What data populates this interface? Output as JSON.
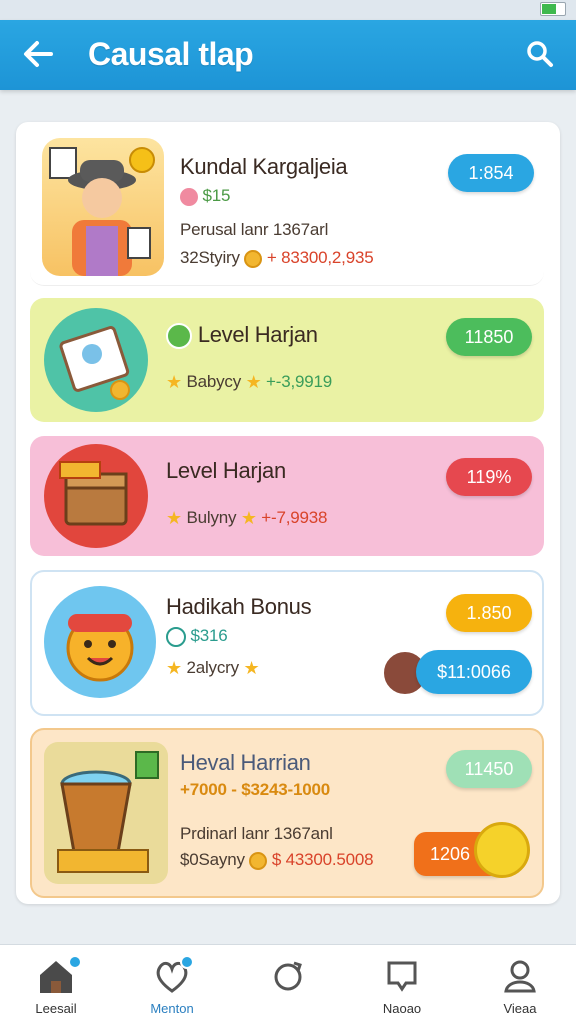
{
  "app": {
    "title": "Causal tlap"
  },
  "cards": [
    {
      "title": "Kundal Kargaljeia",
      "line1": "$15",
      "line2": "Perusal lanr 1367arl",
      "line3a": "32Styiry",
      "line3b": "+ 83300,2,935",
      "pill": "1:854"
    },
    {
      "title": "Level Harjan",
      "line1a": "Babycy",
      "line1b": "+-3,9919",
      "pill": "11850"
    },
    {
      "title": "Level Harjan",
      "line1a": "Bulyny",
      "line1b": "+-7,9938",
      "pill": "119%"
    },
    {
      "title": "Hadikah Bonus",
      "line1": "$316",
      "line2": "2alycry",
      "pill1": "1.850",
      "pill2": "$11:0066"
    },
    {
      "title": "Heval Harrian",
      "line1": "+7000 - $3243-1000",
      "line2": "Prdinarl lanr 1367anl",
      "line3a": "$0Sayny",
      "line3b": "$ 43300.5008",
      "pill1": "11450",
      "pill2": "1206"
    }
  ],
  "nav": [
    {
      "label": "Leesail"
    },
    {
      "label": "Menton"
    },
    {
      "label": ""
    },
    {
      "label": "Naoao"
    },
    {
      "label": "Vieaa"
    }
  ],
  "colors": {
    "appbar": "#1d94d6",
    "blue_pill": "#2aa6e2",
    "green_pill": "#4cbd5c",
    "red_pill": "#e6484f",
    "yellow_pill": "#f6b20e",
    "mint_pill": "#9fe0b6",
    "orange_pill": "#f0701a"
  }
}
